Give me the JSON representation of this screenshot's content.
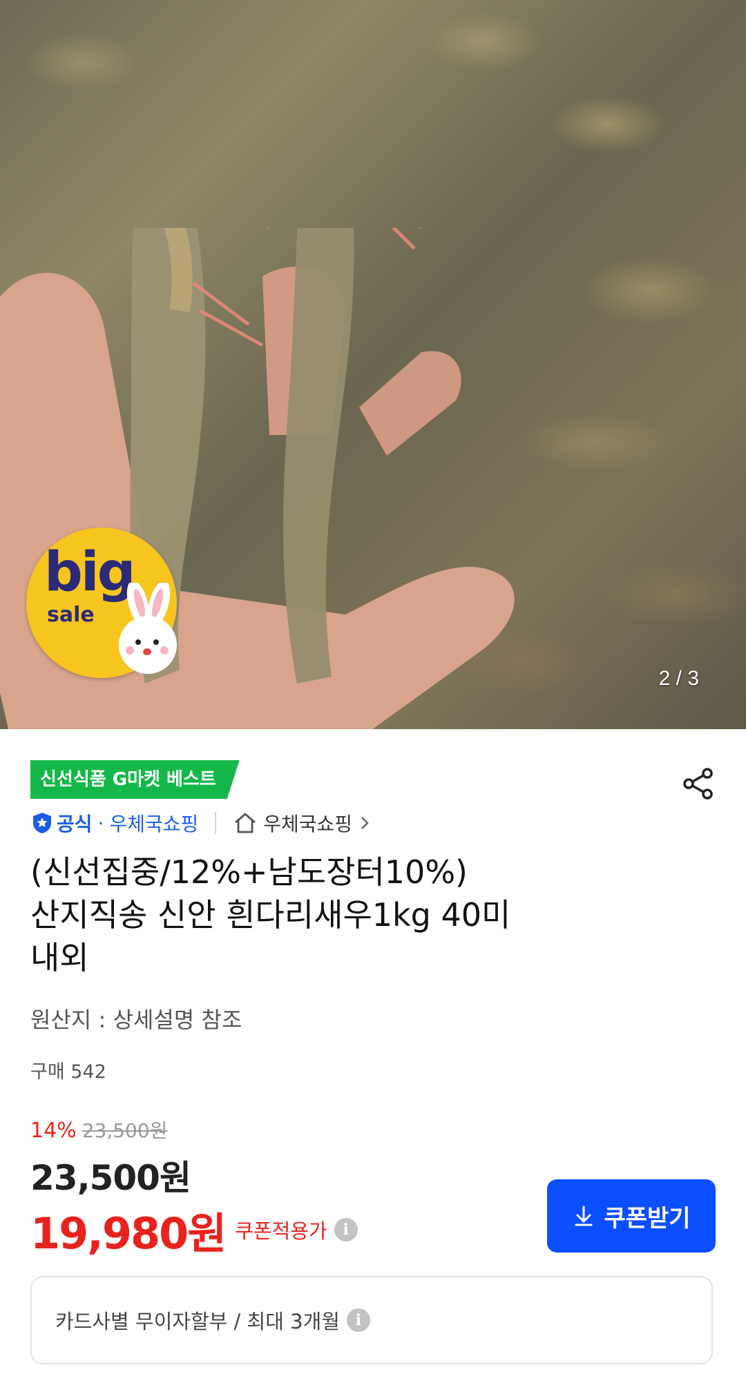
{
  "hero": {
    "image_description_icon": "shrimp-photo",
    "badge": {
      "big": "big",
      "sale": "sale"
    },
    "page_indicator": "2 / 3"
  },
  "product": {
    "tag": "신선식품 G마켓 베스트",
    "official_label": "공식",
    "seller_dot": "·",
    "seller_link": "우체국쇼핑",
    "store_name": "우체국쇼핑",
    "title_line1": "(신선집중/12%+남도장터10%)",
    "title_line2": "산지직송 신안 흰다리새우1kg 40미",
    "title_line3": "내외",
    "origin": "원산지 : 상세설명 참조",
    "purchase_count": "구매 542"
  },
  "pricing": {
    "discount_rate": "14%",
    "original_price": "23,500원",
    "price": "23,500원",
    "coupon_price": "19,980원",
    "coupon_label": "쿠폰적용가",
    "coupon_button": "쿠폰받기"
  },
  "installment": {
    "text": "카드사별 무이자할부 / 최대 3개월"
  },
  "colors": {
    "accent_blue": "#0c4fff",
    "sale_red": "#e8231e",
    "tag_green": "#14b84a",
    "badge_yellow": "#f7c51e"
  }
}
